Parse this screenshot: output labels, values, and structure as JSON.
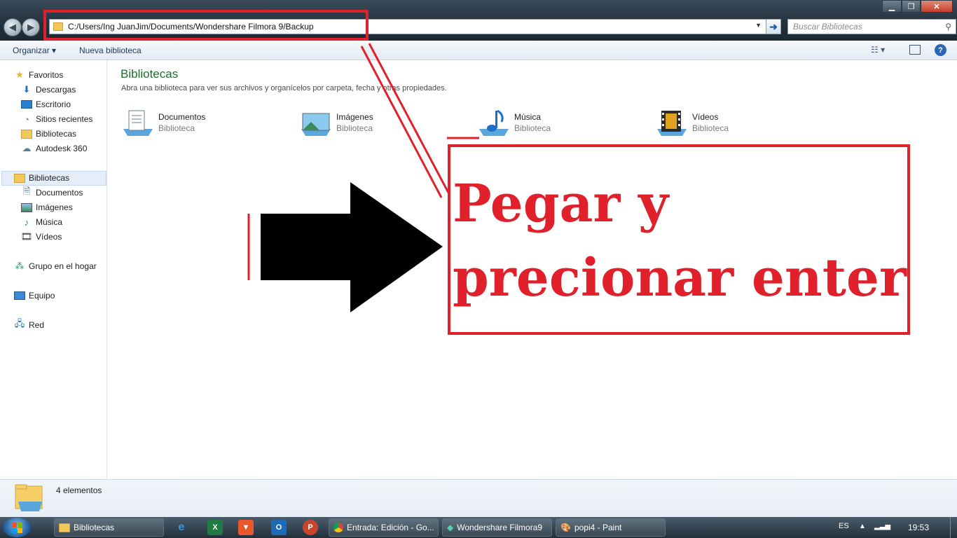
{
  "address_bar": {
    "path": "C:/Users/Ing JuanJim/Documents/Wondershare Filmora 9/Backup"
  },
  "search": {
    "placeholder": "Buscar Bibliotecas"
  },
  "toolbar": {
    "organize": "Organizar ▾",
    "new_library": "Nueva biblioteca"
  },
  "sidebar": {
    "favorites_header": "Favoritos",
    "favorites": [
      "Descargas",
      "Escritorio",
      "Sitios recientes",
      "Bibliotecas",
      "Autodesk 360"
    ],
    "libraries_header": "Bibliotecas",
    "libraries": [
      "Documentos",
      "Imágenes",
      "Música",
      "Vídeos"
    ],
    "homegroup": "Grupo en el hogar",
    "computer": "Equipo",
    "network": "Red"
  },
  "main": {
    "title": "Bibliotecas",
    "subtitle": "Abra una biblioteca para ver sus archivos y organícelos por carpeta, fecha y otras propiedades.",
    "items": [
      {
        "name": "Documentos",
        "type": "Biblioteca",
        "icon": "documents-library-icon"
      },
      {
        "name": "Imágenes",
        "type": "Biblioteca",
        "icon": "pictures-library-icon"
      },
      {
        "name": "Música",
        "type": "Biblioteca",
        "icon": "music-library-icon"
      },
      {
        "name": "Vídeos",
        "type": "Biblioteca",
        "icon": "videos-library-icon"
      }
    ]
  },
  "status": {
    "count": "4 elementos"
  },
  "annotation": {
    "line1": "Pegar y",
    "line2": "precionar enter",
    "color": "#e0202a"
  },
  "taskbar": {
    "tasks": [
      "Bibliotecas",
      "Entrada: Edición - Go...",
      "Wondershare Filmora9",
      "popi4 - Paint"
    ],
    "language": "ES",
    "time": "19:53"
  },
  "colors": {
    "title_green": "#1e6e2a",
    "annotation_red": "#e0202a"
  }
}
